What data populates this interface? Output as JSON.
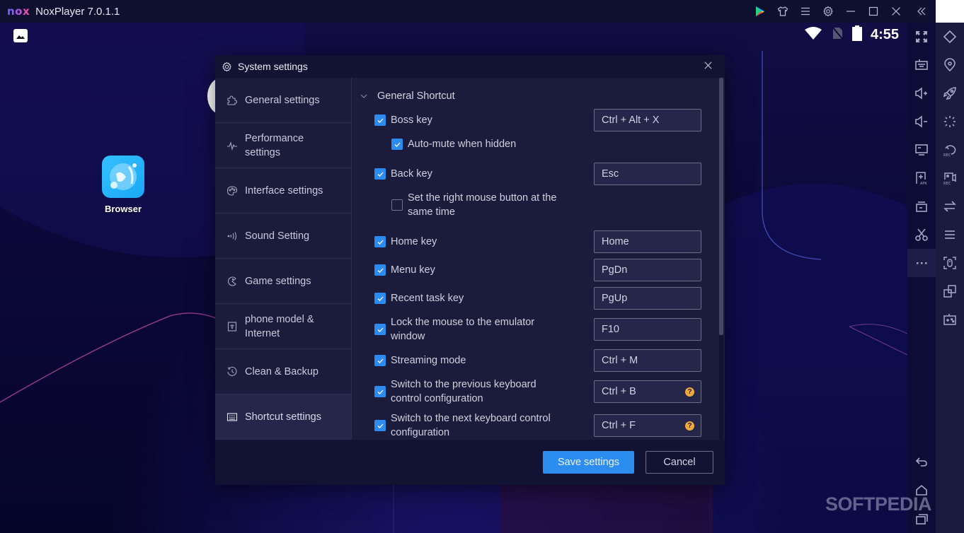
{
  "window": {
    "logo": "nox",
    "title": "NoxPlayer 7.0.1.1",
    "controls": [
      "play-store-icon",
      "theme-shirt-icon",
      "menu-icon",
      "settings-gear-icon",
      "minimize-icon",
      "maximize-icon",
      "close-icon",
      "collapse-sidebar-icon"
    ]
  },
  "statusbar": {
    "time": "4:55",
    "icons": [
      "gallery-icon",
      "wifi-icon",
      "no-sim-icon",
      "battery-icon"
    ]
  },
  "desktop": {
    "apps": [
      {
        "label": "Browser",
        "icon": "browser-icon"
      }
    ]
  },
  "sidebar_left": [
    {
      "name": "fullscreen",
      "icon": "fullscreen-icon"
    },
    {
      "name": "keyboard",
      "icon": "keyboard-icon"
    },
    {
      "name": "volume-up",
      "icon": "volume-up-icon"
    },
    {
      "name": "volume-down",
      "icon": "volume-down-icon"
    },
    {
      "name": "screen",
      "icon": "display-icon"
    },
    {
      "name": "apk-install",
      "icon": "apk-icon"
    },
    {
      "name": "toolbox",
      "icon": "toolbox-icon"
    },
    {
      "name": "screenshot",
      "icon": "scissors-icon"
    },
    {
      "name": "more",
      "icon": "more-icon"
    },
    {
      "name": "back",
      "icon": "back-icon"
    },
    {
      "name": "home",
      "icon": "home-icon"
    },
    {
      "name": "recent",
      "icon": "recent-apps-icon"
    }
  ],
  "sidebar_right": [
    {
      "name": "rotate",
      "icon": "rotate-icon"
    },
    {
      "name": "location",
      "icon": "location-icon"
    },
    {
      "name": "boost",
      "icon": "rocket-icon"
    },
    {
      "name": "loading",
      "icon": "spinner-icon"
    },
    {
      "name": "macro-record",
      "icon": "macro-rec-icon",
      "badge": "REC"
    },
    {
      "name": "video-record",
      "icon": "video-rec-icon",
      "badge": "REC"
    },
    {
      "name": "sync",
      "icon": "sync-arrows-icon"
    },
    {
      "name": "list",
      "icon": "list-icon"
    },
    {
      "name": "mouse-lock",
      "icon": "mouse-lock-icon"
    },
    {
      "name": "multi-instance",
      "icon": "multi-instance-icon"
    },
    {
      "name": "gamepad",
      "icon": "gamepad-icon"
    }
  ],
  "dialog": {
    "title": "System settings",
    "nav": [
      {
        "label": "General settings",
        "icon": "puzzle-icon",
        "active": false
      },
      {
        "label": "Performance settings",
        "icon": "pulse-icon",
        "active": false
      },
      {
        "label": "Interface settings",
        "icon": "palette-icon",
        "active": false
      },
      {
        "label": "Sound Setting",
        "icon": "sound-icon",
        "active": false
      },
      {
        "label": "Game settings",
        "icon": "game-icon",
        "active": false
      },
      {
        "label": "phone model & Internet",
        "icon": "phone-icon",
        "active": false
      },
      {
        "label": "Clean & Backup",
        "icon": "history-icon",
        "active": false
      },
      {
        "label": "Shortcut settings",
        "icon": "keyboard-icon",
        "active": true
      }
    ],
    "section_title": "General Shortcut",
    "shortcuts": [
      {
        "label": "Boss key",
        "checked": true,
        "key": "Ctrl + Alt + X"
      },
      {
        "label": "Auto-mute when hidden",
        "checked": true,
        "sub": true
      },
      {
        "label": "Back key",
        "checked": true,
        "key": "Esc"
      },
      {
        "label": "Set the right mouse button at the same time",
        "checked": false,
        "sub": true
      },
      {
        "label": "Home key",
        "checked": true,
        "key": "Home"
      },
      {
        "label": "Menu key",
        "checked": true,
        "key": "PgDn"
      },
      {
        "label": "Recent task key",
        "checked": true,
        "key": "PgUp"
      },
      {
        "label": "Lock the mouse to the emulator window",
        "checked": true,
        "key": "F10"
      },
      {
        "label": "Streaming mode",
        "checked": true,
        "key": "Ctrl + M"
      },
      {
        "label": "Switch to the previous keyboard control configuration",
        "checked": true,
        "key": "Ctrl + B",
        "help": "?"
      },
      {
        "label": "Switch to the next keyboard control configuration",
        "checked": true,
        "key": "Ctrl + F",
        "help": "?"
      }
    ],
    "save_label": "Save settings",
    "cancel_label": "Cancel"
  },
  "watermark": "SOFTPEDIA",
  "colors": {
    "accent": "#2d8cf0",
    "help": "#f2a93b",
    "dialog_bg": "#1b1c3c"
  }
}
